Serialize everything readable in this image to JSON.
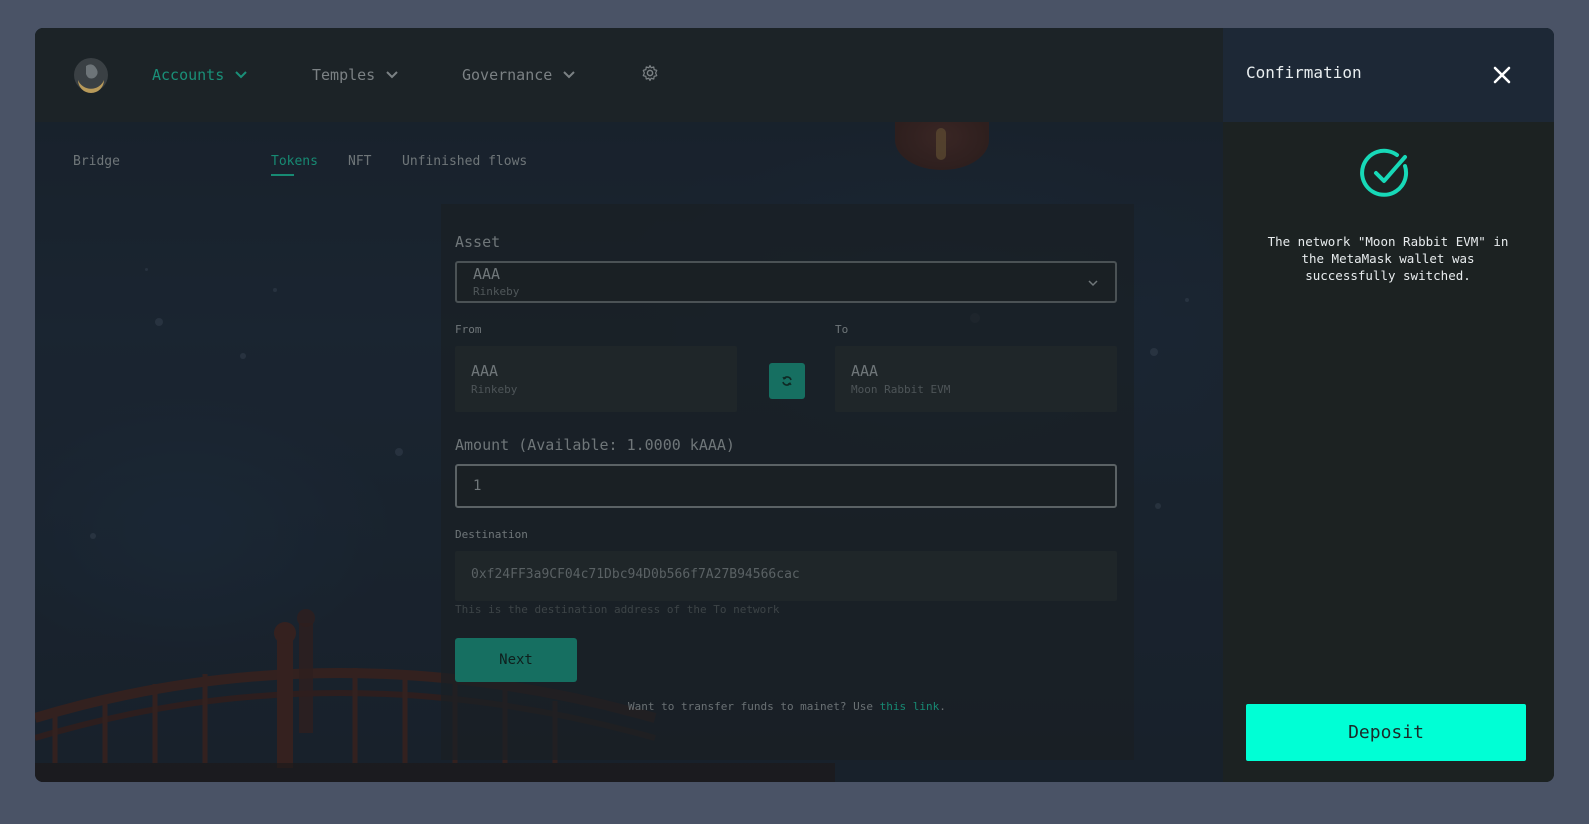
{
  "nav": {
    "items": [
      {
        "label": "Accounts",
        "active": true
      },
      {
        "label": "Temples",
        "active": false
      },
      {
        "label": "Governance",
        "active": false
      }
    ]
  },
  "subnav": {
    "section": "Bridge",
    "tabs": [
      {
        "label": "Tokens",
        "active": true
      },
      {
        "label": "NFT",
        "active": false
      },
      {
        "label": "Unfinished flows",
        "active": false
      }
    ]
  },
  "form": {
    "asset_label": "Asset",
    "asset_value": "AAA",
    "asset_network": "Rinkeby",
    "from_label": "From",
    "from_token": "AAA",
    "from_network": "Rinkeby",
    "to_label": "To",
    "to_token": "AAA",
    "to_network": "Moon Rabbit EVM",
    "amount_label": "Amount (Available: 1.0000 kAAA)",
    "amount_value": "1",
    "destination_label": "Destination",
    "destination_value": "0xf24FF3a9CF04c71Dbc94D0b566f7A27B94566cac",
    "destination_hint": "This is the destination address of the To network",
    "next_label": "Next",
    "footer_text": "Want to transfer funds to mainet? Use ",
    "footer_link": "this link",
    "footer_end": "."
  },
  "panel": {
    "title": "Confirmation",
    "message": "The network \"Moon Rabbit EVM\" in the MetaMask wallet was successfully switched.",
    "deposit_label": "Deposit"
  },
  "colors": {
    "accent": "#00ffd5",
    "nav_active": "#1a8f78",
    "success": "#17d9b8"
  }
}
